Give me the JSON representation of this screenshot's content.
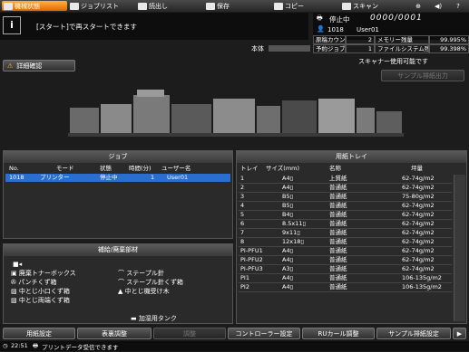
{
  "tabs": [
    {
      "label": "機械状態",
      "icon": "machine-icon",
      "active": true
    },
    {
      "label": "ジョブリスト",
      "icon": "job-list-icon"
    },
    {
      "label": "読出し",
      "icon": "retrieve-icon"
    },
    {
      "label": "保存",
      "icon": "store-icon"
    },
    {
      "label": "コピー",
      "icon": "copy-icon"
    },
    {
      "label": "スキャン",
      "icon": "scan-icon"
    }
  ],
  "message": "[スタート]で再スタートできます",
  "status": {
    "state": "停止中",
    "counter": "0000/0001",
    "job_id": "1018",
    "user": "User01",
    "main_unit_label": "本体",
    "scanner_available": "スキャナー使用可能です"
  },
  "info": {
    "original_counter_label": "原稿カウンター",
    "original_counter_value": "2",
    "memory_label": "メモリー残量",
    "memory_value": "99.995%",
    "reserved_jobs_label": "予約ジョブ数",
    "reserved_jobs_value": "1",
    "filesystem_label": "ファイルシステム残量",
    "filesystem_value": "99.398%"
  },
  "detail_button": "詳細確認",
  "sample_output_button": "サンプル排紙出力",
  "jobs": {
    "title": "ジョブ",
    "headers": [
      "No.",
      "モード",
      "状態",
      "時間(分)",
      "ユーザー名"
    ],
    "rows": [
      [
        "1018",
        "プリンター",
        "停止中",
        "1",
        "User01"
      ]
    ]
  },
  "paper_tray": {
    "title": "用紙トレイ",
    "headers": [
      "トレイ",
      "サイズ(mm)",
      "名称",
      "坪量"
    ],
    "rows": [
      [
        "1",
        "A4▯",
        "上質紙",
        "62-74g/m2"
      ],
      [
        "2",
        "A4▯",
        "普通紙",
        "62-74g/m2"
      ],
      [
        "3",
        "B5▯",
        "普通紙",
        "75-80g/m2"
      ],
      [
        "4",
        "B5▯",
        "普通紙",
        "62-74g/m2"
      ],
      [
        "5",
        "B4▯",
        "普通紙",
        "62-74g/m2"
      ],
      [
        "6",
        "8.5x11▯",
        "普通紙",
        "62-74g/m2"
      ],
      [
        "7",
        "9x11▯",
        "普通紙",
        "62-74g/m2"
      ],
      [
        "8",
        "12x18▯",
        "普通紙",
        "62-74g/m2"
      ],
      [
        "PI-PFU1",
        "A4▯",
        "普通紙",
        "62-74g/m2"
      ],
      [
        "PI-PFU2",
        "A4▯",
        "普通紙",
        "62-74g/m2"
      ],
      [
        "PI-PFU3",
        "A3▯",
        "普通紙",
        "62-74g/m2"
      ],
      [
        "PI1",
        "A4▯",
        "普通紙",
        "106-135g/m2"
      ],
      [
        "PI2",
        "A4▯",
        "普通紙",
        "106-135g/m2"
      ]
    ]
  },
  "supplies": {
    "title": "補給/廃棄部材",
    "left": [
      "廃棄トナーボックス",
      "パンチくず箱",
      "中とじ小口くず箱",
      "中とじ両端くず箱"
    ],
    "right": [
      "ステープル針",
      "ステープル針くず箱",
      "中とじ機受け木"
    ],
    "extra": "加湿用タンク"
  },
  "bottom_buttons": [
    {
      "label": "用紙設定"
    },
    {
      "label": "表裏調整"
    },
    {
      "label": "調整",
      "disabled": true
    },
    {
      "label": "コントローラー設定"
    },
    {
      "label": "RUカール調整"
    },
    {
      "label": "サンプル排紙設定"
    }
  ],
  "footer": {
    "time": "22:51",
    "message": "プリントデータ受信できます"
  }
}
